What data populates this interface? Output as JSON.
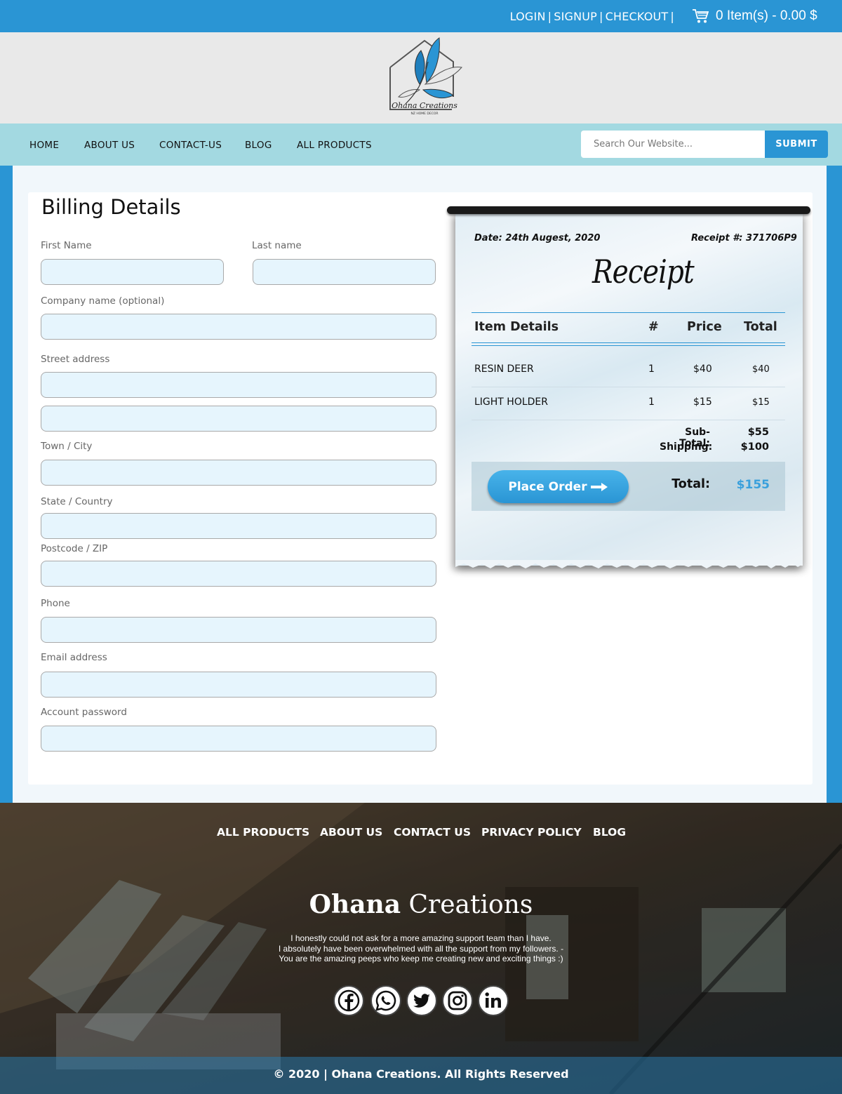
{
  "topbar": {
    "links": [
      "LOGIN",
      "SIGNUP",
      "CHECKOUT"
    ],
    "separator": "|",
    "cart_text": "0 Item(s) - 0.00 $",
    "cart_icon": "shopping-cart-icon"
  },
  "logo": {
    "line1": "Ohana Creations",
    "line2": "NZ HOME DECOR"
  },
  "nav": {
    "items": [
      "HOME",
      "ABOUT US",
      "CONTACT-US",
      "BLOG",
      "ALL PRODUCTS"
    ],
    "search_placeholder": "Search Our Website...",
    "submit_label": "SUBMIT"
  },
  "billing": {
    "title": "Billing Details",
    "fields": {
      "first_name": "First Name",
      "last_name": "Last name",
      "company": "Company name (optional)",
      "street": "Street address",
      "town": "Town / City",
      "state": "State / Country",
      "postcode": "Postcode / ZIP",
      "phone": "Phone",
      "email": "Email address",
      "password": "Account password"
    }
  },
  "receipt": {
    "date": "Date: 24th Augest, 2020",
    "receipt_no": "Receipt #: 371706P9",
    "title": "Receipt",
    "headers": {
      "item": "Item Details",
      "qty": "#",
      "price": "Price",
      "total": "Total"
    },
    "rows": [
      {
        "item": "RESIN DEER",
        "qty": "1",
        "price": "$40",
        "total": "$40"
      },
      {
        "item": "LIGHT HOLDER",
        "qty": "1",
        "price": "$15",
        "total": "$15"
      }
    ],
    "subtotal_label": "Sub-Total:",
    "subtotal": "$55",
    "shipping_label": "Shipping:",
    "shipping": "$100",
    "total_label": "Total:",
    "total": "$155",
    "place_order": "Place Order"
  },
  "footer": {
    "nav": [
      "ALL PRODUCTS",
      "ABOUT US",
      "CONTACT US",
      "PRIVACY POLICY",
      "BLOG"
    ],
    "brand_bold": "Ohana",
    "brand_rest": " Creations",
    "quote": "I honestly could not ask for a more amazing support team than I have.\nI absolutely have been overwhelmed with all the  support from my followers. -\nYou are the amazing peeps who keep me creating new and exciting things :)",
    "social": [
      "facebook-icon",
      "whatsapp-icon",
      "twitter-icon",
      "instagram-icon",
      "linkedin-icon"
    ],
    "copyright": "© 2020 | Ohana Creations. All Rights Reserved"
  },
  "colors": {
    "primary": "#2a95d4",
    "nav_bg": "#a3d9e1",
    "input_bg": "#e6f5fd",
    "logo_band": "#e9e9e9"
  }
}
